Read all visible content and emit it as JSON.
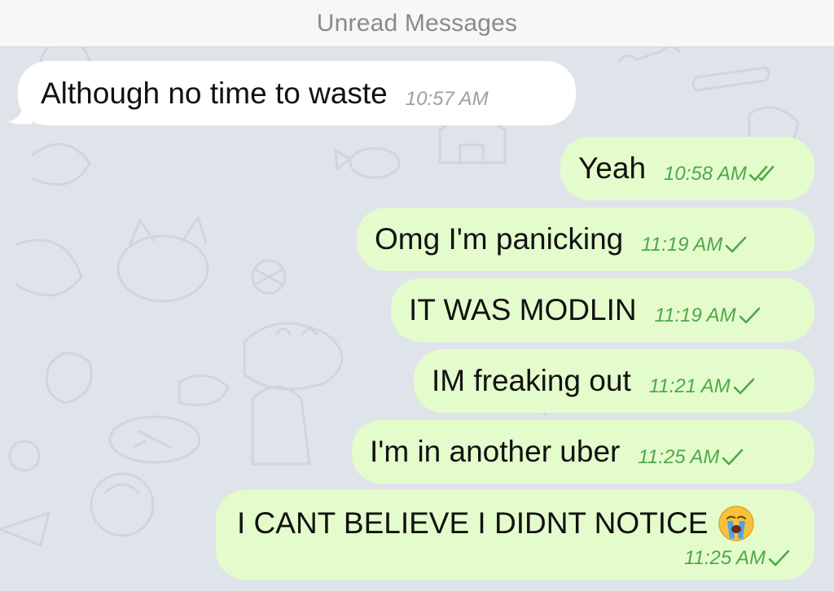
{
  "header": {
    "title": "Unread Messages"
  },
  "icons": {
    "read_receipt": "double-check-icon",
    "sent_receipt": "check-icon",
    "emoji": "loudly-crying-face-icon"
  },
  "colors": {
    "incoming_bubble": "#ffffff",
    "outgoing_bubble": "#e4fccc",
    "outgoing_time": "#4ea84a",
    "incoming_time": "#9aa0a6",
    "background": "#dfe4ea"
  },
  "messages": [
    {
      "direction": "incoming",
      "text": "Although no time to waste",
      "time": "10:57 AM"
    },
    {
      "direction": "outgoing",
      "text": "Yeah",
      "time": "10:58 AM",
      "status": "read"
    },
    {
      "direction": "outgoing",
      "text": "Omg I'm panicking",
      "time": "11:19 AM",
      "status": "sent"
    },
    {
      "direction": "outgoing",
      "text": "IT WAS MODLIN",
      "time": "11:19 AM",
      "status": "sent"
    },
    {
      "direction": "outgoing",
      "text": "IM freaking out",
      "time": "11:21 AM",
      "status": "sent"
    },
    {
      "direction": "outgoing",
      "text": "I'm in another uber",
      "time": "11:25 AM",
      "status": "sent"
    },
    {
      "direction": "outgoing",
      "text": "I CANT BELIEVE I DIDNT NOTICE",
      "time": "11:25 AM",
      "status": "sent"
    }
  ]
}
